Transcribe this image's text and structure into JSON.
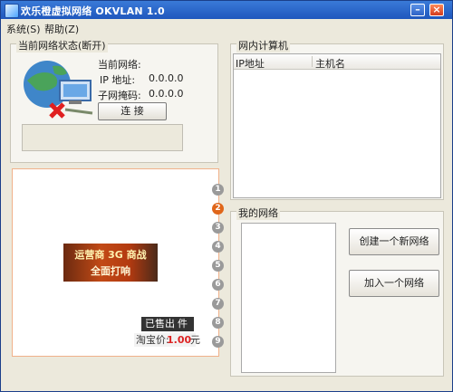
{
  "window": {
    "title": "欢乐橙虚拟网络 OKVLAN 1.0",
    "controls": {
      "minimize": "–",
      "close": "×"
    }
  },
  "menu": {
    "system": "系统(S)",
    "help": "帮助(Z)"
  },
  "status_group": {
    "title": "当前网络状态(断开)",
    "network_label": "当前网络:",
    "network_value": "",
    "ip_label": "IP  地址:",
    "ip_value": "0.0.0.0",
    "mask_label": "子网掩码:",
    "mask_value": "0.0.0.0",
    "connect_button": "连 接",
    "status_text": ""
  },
  "lan_group": {
    "title": "网内计算机",
    "columns": [
      "IP地址",
      "主机名"
    ],
    "rows": []
  },
  "mynet_group": {
    "title": "我的网络",
    "networks": [],
    "create_button": "创建一个新网络",
    "join_button": "加入一个网络"
  },
  "ad": {
    "banner_line1": "运营商 3G 商战",
    "banner_line2": "全面打响",
    "sold_prefix": "已售出",
    "sold_count": "",
    "sold_unit": "件",
    "price_label": "淘宝价:",
    "price_value": "1.00",
    "price_unit": "元",
    "pager": [
      "1",
      "2",
      "3",
      "4",
      "5",
      "6",
      "7",
      "8",
      "9"
    ],
    "active_page": "2"
  },
  "colors": {
    "titlebar": "#2a63c9",
    "ad_border": "#f0b18a",
    "price": "#d22222",
    "active_page": "#e0661a"
  }
}
